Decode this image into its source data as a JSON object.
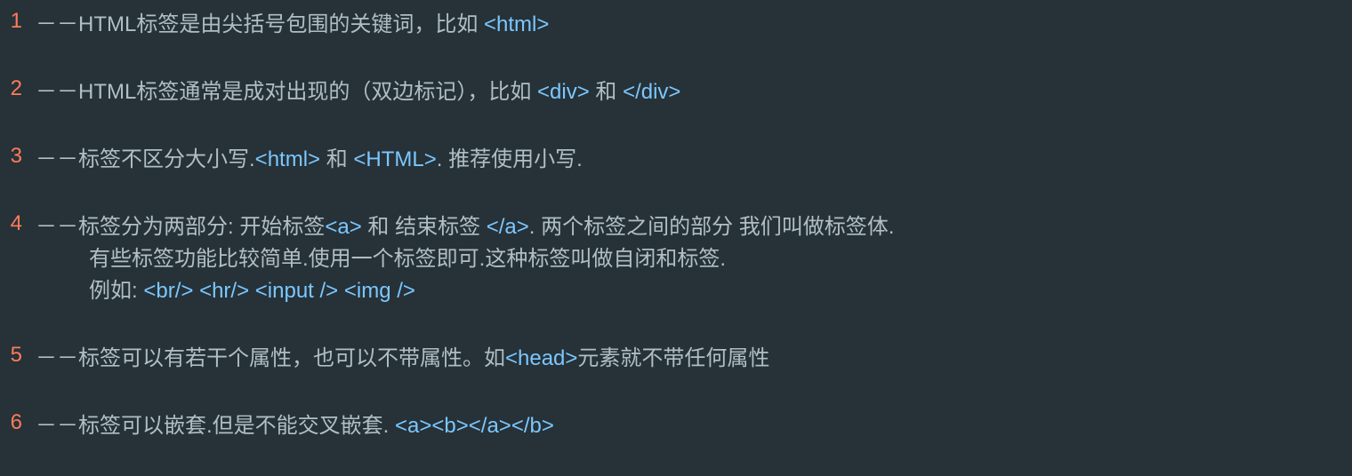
{
  "lines": [
    {
      "number": "1",
      "segments": [
        {
          "text": "－－HTML标签是由尖括号包围的关键词，比如 ",
          "highlight": false
        },
        {
          "text": "<html>",
          "highlight": true
        }
      ]
    },
    {
      "number": "2",
      "segments": [
        {
          "text": "－－HTML标签通常是成对出现的（双边标记），比如 ",
          "highlight": false
        },
        {
          "text": "<div>",
          "highlight": true
        },
        {
          "text": " 和 ",
          "highlight": false
        },
        {
          "text": "</div>",
          "highlight": true
        }
      ]
    },
    {
      "number": "3",
      "segments": [
        {
          "text": "－－标签不区分大小写.",
          "highlight": false
        },
        {
          "text": "<html>",
          "highlight": true
        },
        {
          "text": " 和 ",
          "highlight": false
        },
        {
          "text": "<HTML>",
          "highlight": true
        },
        {
          "text": ". 推荐使用小写.",
          "highlight": false
        }
      ]
    },
    {
      "number": "4",
      "segments": [
        {
          "text": "－－标签分为两部分: 开始标签",
          "highlight": false
        },
        {
          "text": "<a>",
          "highlight": true
        },
        {
          "text": " 和 结束标签 ",
          "highlight": false
        },
        {
          "text": "</a>",
          "highlight": true
        },
        {
          "text": ". 两个标签之间的部分 我们叫做标签体.",
          "highlight": false
        }
      ],
      "sublines": [
        {
          "segments": [
            {
              "text": "有些标签功能比较简单.使用一个标签即可.这种标签叫做自闭和标签.",
              "highlight": false
            }
          ]
        },
        {
          "segments": [
            {
              "text": "例如: ",
              "highlight": false
            },
            {
              "text": "<br/>",
              "highlight": true
            },
            {
              "text": "  ",
              "highlight": false
            },
            {
              "text": "<hr/>",
              "highlight": true
            },
            {
              "text": "  ",
              "highlight": false
            },
            {
              "text": "<input />",
              "highlight": true
            },
            {
              "text": "  ",
              "highlight": false
            },
            {
              "text": "<img />",
              "highlight": true
            }
          ]
        }
      ]
    },
    {
      "number": "5",
      "segments": [
        {
          "text": "－－标签可以有若干个属性，也可以不带属性。如",
          "highlight": false
        },
        {
          "text": "<head>",
          "highlight": true
        },
        {
          "text": "元素就不带任何属性",
          "highlight": false
        }
      ]
    },
    {
      "number": "6",
      "segments": [
        {
          "text": "－－标签可以嵌套.但是不能交叉嵌套. ",
          "highlight": false
        },
        {
          "text": "<a><b></a></b>",
          "highlight": true
        }
      ]
    }
  ]
}
